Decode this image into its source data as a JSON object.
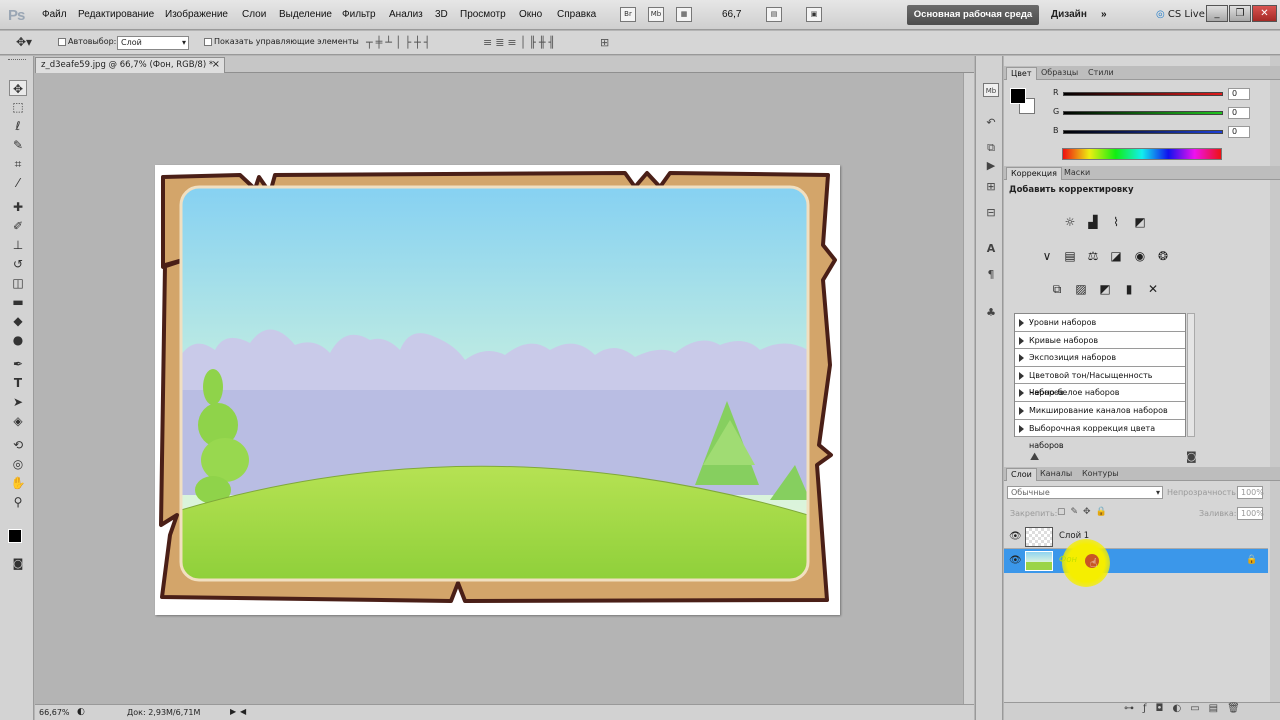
{
  "app": {
    "logo": "Ps"
  },
  "menu": [
    "Файл",
    "Редактирование",
    "Изображение",
    "Слои",
    "Выделение",
    "Фильтр",
    "Анализ",
    "3D",
    "Просмотр",
    "Окно",
    "Справка"
  ],
  "menubar": {
    "zoom": "66,7",
    "workspace": "Основная рабочая среда",
    "design": "Дизайн",
    "more": "»",
    "cslive": "CS Live",
    "br_icon": "Br",
    "mb_icon": "Mb"
  },
  "options": {
    "autoselect_label": "Автовыбор:",
    "autoselect_value": "Слой",
    "show_controls": "Показать управляющие элементы"
  },
  "document": {
    "tab_title": "z_d3eafe59.jpg @ 66,7% (Фон, RGB/8) *",
    "tab_close": "×"
  },
  "status": {
    "zoom": "66,67%",
    "doc_size": "Док: 2,93M/6,71M"
  },
  "color_panel": {
    "tabs": [
      "Цвет",
      "Образцы",
      "Стили"
    ],
    "active_tab": 0,
    "channels": [
      {
        "label": "R",
        "value": "0",
        "color": "#d21b1b"
      },
      {
        "label": "G",
        "value": "0",
        "color": "#1fb31f"
      },
      {
        "label": "B",
        "value": "0",
        "color": "#1d3fd6"
      }
    ]
  },
  "adjust_panel": {
    "tabs": [
      "Коррекция",
      "Маски"
    ],
    "active_tab": 0,
    "heading": "Добавить корректировку",
    "presets": [
      "Уровни наборов",
      "Кривые наборов",
      "Экспозиция наборов",
      "Цветовой тон/Насыщенность наборов",
      "Черно-белое наборов",
      "Микширование каналов наборов",
      "Выборочная коррекция цвета наборов"
    ]
  },
  "layers_panel": {
    "tabs": [
      "Слои",
      "Каналы",
      "Контуры"
    ],
    "active_tab": 0,
    "blend_mode": "Обычные",
    "opacity_label": "Непрозрачность:",
    "opacity_value": "100%",
    "lock_label": "Закрепить:",
    "fill_label": "Заливка:",
    "fill_value": "100%",
    "layers": [
      {
        "name": "Слой 1",
        "selected": false
      },
      {
        "name": "Фон",
        "selected": true
      }
    ]
  },
  "icons": {
    "eye": "eye-icon",
    "lock": "lock-icon",
    "move": "move-tool-icon"
  },
  "colors": {
    "selection": "#3b97ea",
    "cursor_highlight": "#f2e600",
    "frame_wood": "#d3a56a",
    "frame_outline": "#4a1f17"
  }
}
